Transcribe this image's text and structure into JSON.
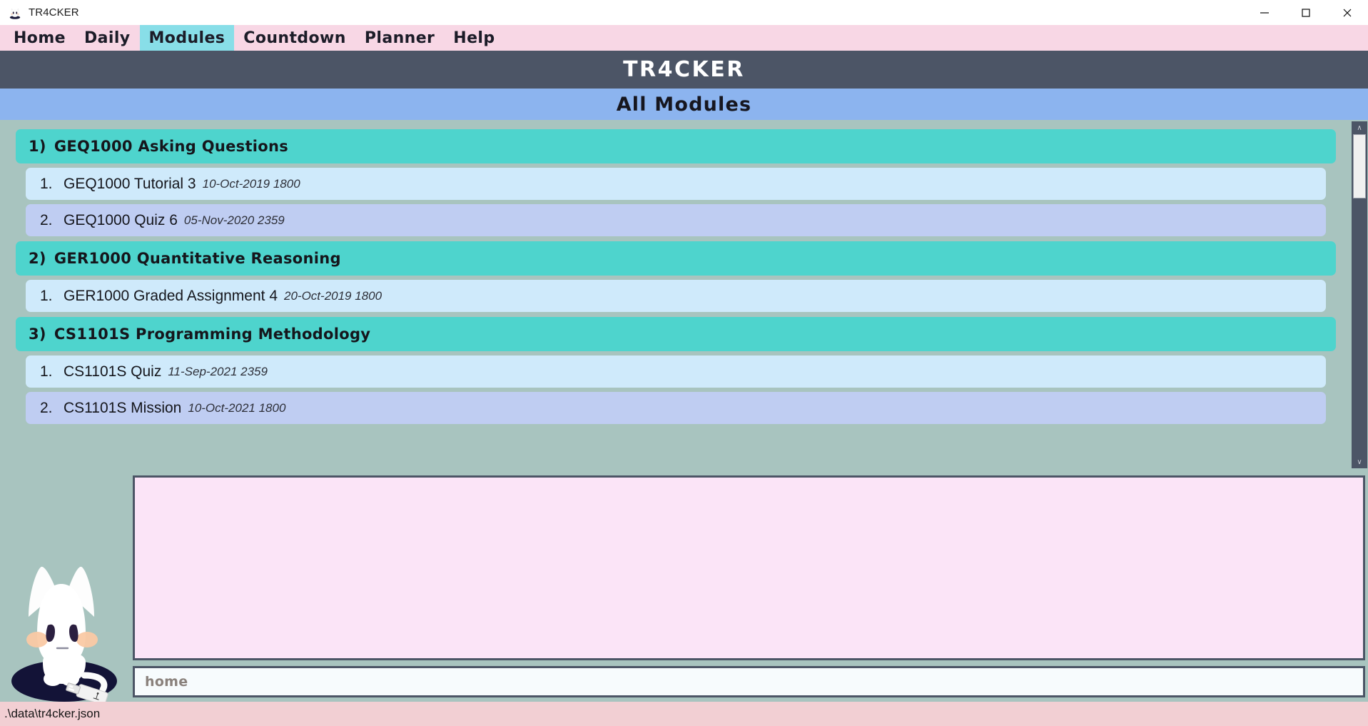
{
  "window": {
    "title": "TR4CKER",
    "icon": "cat-icon",
    "controls": {
      "minimize": "—",
      "maximize": "☐",
      "close": "✕"
    }
  },
  "menubar": {
    "items": [
      {
        "label": "Home",
        "active": false
      },
      {
        "label": "Daily",
        "active": false
      },
      {
        "label": "Modules",
        "active": true
      },
      {
        "label": "Countdown",
        "active": false
      },
      {
        "label": "Planner",
        "active": false
      },
      {
        "label": "Help",
        "active": false
      }
    ]
  },
  "header": {
    "brand": "TR4CKER",
    "subtitle": "All Modules"
  },
  "modules": [
    {
      "index": "1)",
      "name": "GEQ1000 Asking Questions",
      "tasks": [
        {
          "num": "1.",
          "name": "GEQ1000 Tutorial 3",
          "date": "10-Oct-2019 1800"
        },
        {
          "num": "2.",
          "name": "GEQ1000 Quiz 6",
          "date": "05-Nov-2020 2359"
        }
      ]
    },
    {
      "index": "2)",
      "name": "GER1000 Quantitative Reasoning",
      "tasks": [
        {
          "num": "1.",
          "name": "GER1000 Graded Assignment 4",
          "date": "20-Oct-2019 1800"
        }
      ]
    },
    {
      "index": "3)",
      "name": "CS1101S Programming Methodology",
      "tasks": [
        {
          "num": "1.",
          "name": "CS1101S Quiz",
          "date": "11-Sep-2021 2359"
        },
        {
          "num": "2.",
          "name": "CS1101S Mission",
          "date": "10-Oct-2021 1800"
        }
      ]
    }
  ],
  "scrollbar": {
    "up_arrow": "∧",
    "down_arrow": "∨"
  },
  "console": {
    "output_text": "",
    "input_placeholder": "home"
  },
  "statusbar": {
    "path": ".\\data\\tr4cker.json"
  },
  "colors": {
    "menubar_bg": "#f8d7e5",
    "menu_active_bg": "#88dee8",
    "header_bg": "#4c5566",
    "subheader_bg": "#8cb4ef",
    "page_bg": "#a8c4bf",
    "module_header_bg": "#4ed4cd",
    "task_odd_bg": "#cfeafb",
    "task_even_bg": "#bfcdf2",
    "output_bg": "#fbe4f7",
    "input_bg": "#f7fbfd",
    "statusbar_bg": "#f2cfd3"
  }
}
